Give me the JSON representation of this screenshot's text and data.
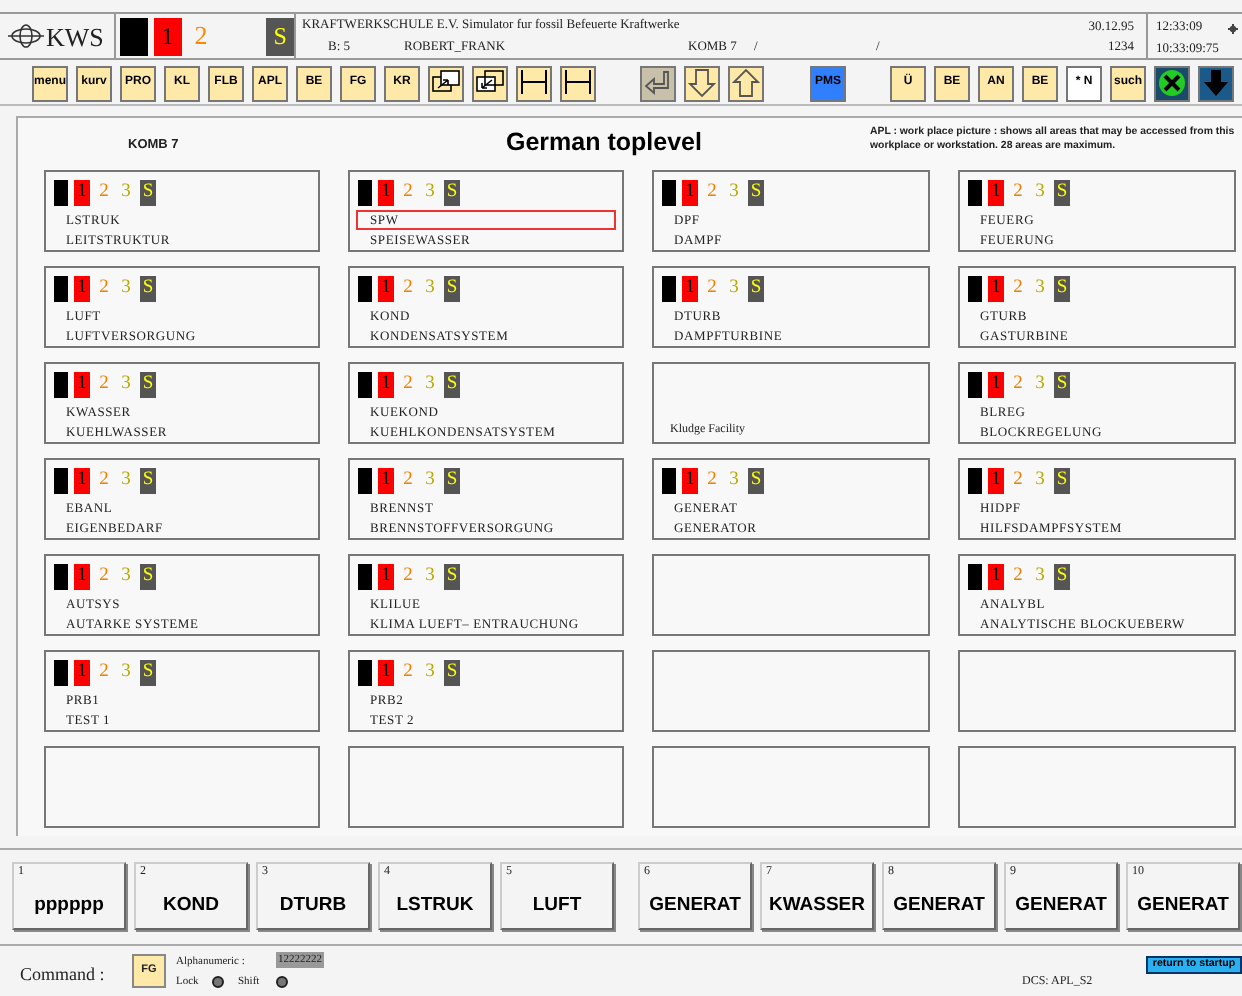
{
  "header": {
    "logo": "KWS",
    "indicators": [
      {
        "kind": "black"
      },
      {
        "kind": "red",
        "label": "1"
      },
      {
        "kind": "orange",
        "label": "2"
      },
      {
        "kind": "gap"
      },
      {
        "kind": "s",
        "label": "S"
      }
    ],
    "org": "KRAFTWERKSCHULE E.V.  Simulator fur fossil Befeuerte Kraftwerke",
    "date": "30.12.95",
    "b": "B: 5",
    "user": "ROBERT_FRANK",
    "unit": "KOMB 7",
    "slash_1": "/",
    "slash_2": "/",
    "code": "1234",
    "time": "12:33:09",
    "time_precise": "10:33:09:75"
  },
  "toolbar": [
    [
      {
        "kind": "text",
        "label": "menu"
      },
      {
        "kind": "text",
        "label": "kurv"
      },
      {
        "kind": "text",
        "label": "PRO"
      },
      {
        "kind": "text",
        "label": "KL"
      },
      {
        "kind": "text",
        "label": "FLB"
      },
      {
        "kind": "text",
        "label": "APL"
      },
      {
        "kind": "text",
        "label": "BE"
      },
      {
        "kind": "text",
        "label": "FG"
      },
      {
        "kind": "text",
        "label": "KR"
      },
      {
        "kind": "window-out"
      },
      {
        "kind": "window-in"
      },
      {
        "kind": "span"
      },
      {
        "kind": "span"
      }
    ],
    [
      {
        "kind": "return",
        "color": "#c8c0a8"
      },
      {
        "kind": "down"
      },
      {
        "kind": "up"
      }
    ],
    [
      {
        "kind": "text",
        "label": "PMS",
        "color": "#2f7fff"
      }
    ],
    [
      {
        "kind": "text",
        "label": "Ü"
      },
      {
        "kind": "text",
        "label": "BE"
      },
      {
        "kind": "text",
        "label": "AN"
      },
      {
        "kind": "text",
        "label": "BE"
      },
      {
        "kind": "text",
        "label": "* N",
        "color": "#ffffff"
      },
      {
        "kind": "text",
        "label": "such"
      },
      {
        "kind": "green-x",
        "color": "#1a4a6a"
      },
      {
        "kind": "blue-down",
        "color": "#1a5a8a"
      }
    ]
  ],
  "panel": {
    "unit": "KOMB 7",
    "title": "German toplevel",
    "info": "APL : work place picture : shows all areas that may be accessed from this workplace or workstation.  28 areas are maximum.",
    "areas": [
      {
        "kind": "area",
        "code": "LSTRUK",
        "name": "LEITSTRUKTUR",
        "selected": false,
        "indicators": [
          "1",
          "2",
          "3",
          "S"
        ]
      },
      {
        "kind": "area",
        "code": "SPW",
        "name": "SPEISEWASSER",
        "selected": true,
        "indicators": [
          "1",
          "2",
          "3",
          "S"
        ]
      },
      {
        "kind": "area",
        "code": "DPF",
        "name": "DAMPF",
        "selected": false,
        "indicators": [
          "1",
          "2",
          "3",
          "S"
        ]
      },
      {
        "kind": "area",
        "code": "FEUERG",
        "name": "FEUERUNG",
        "selected": false,
        "indicators": [
          "1",
          "2",
          "3",
          "S"
        ]
      },
      {
        "kind": "area",
        "code": "LUFT",
        "name": "LUFTVERSORGUNG",
        "selected": false,
        "indicators": [
          "1",
          "2",
          "3",
          "S"
        ]
      },
      {
        "kind": "area",
        "code": "KOND",
        "name": "KONDENSATSYSTEM",
        "selected": false,
        "indicators": [
          "1",
          "2",
          "3",
          "S"
        ]
      },
      {
        "kind": "area",
        "code": "DTURB",
        "name": "DAMPFTURBINE",
        "selected": false,
        "indicators": [
          "1",
          "2",
          "3",
          "S"
        ]
      },
      {
        "kind": "area",
        "code": "GTURB",
        "name": "GASTURBINE",
        "selected": false,
        "indicators": [
          "1",
          "2",
          "3",
          "S"
        ]
      },
      {
        "kind": "area",
        "code": "KWASSER",
        "name": "KUEHLWASSER",
        "selected": false,
        "indicators": [
          "1",
          "2",
          "3",
          "S"
        ]
      },
      {
        "kind": "area",
        "code": "KUEKOND",
        "name": "KUEHLKONDENSATSYSTEM",
        "selected": false,
        "indicators": [
          "1",
          "2",
          "3",
          "S"
        ]
      },
      {
        "kind": "label",
        "text": "Kludge Facility"
      },
      {
        "kind": "area",
        "code": "BLREG",
        "name": "BLOCKREGELUNG",
        "selected": false,
        "indicators": [
          "1",
          "2",
          "3",
          "S"
        ]
      },
      {
        "kind": "area",
        "code": "EBANL",
        "name": "EIGENBEDARF",
        "selected": false,
        "indicators": [
          "1",
          "2",
          "3",
          "S"
        ]
      },
      {
        "kind": "area",
        "code": "BRENNST",
        "name": "BRENNSTOFFVERSORGUNG",
        "selected": false,
        "indicators": [
          "1",
          "2",
          "3",
          "S"
        ]
      },
      {
        "kind": "area",
        "code": "GENERAT",
        "name": "GENERATOR",
        "selected": false,
        "indicators": [
          "1",
          "2",
          "3",
          "S"
        ]
      },
      {
        "kind": "area",
        "code": "HIDPF",
        "name": "HILFSDAMPFSYSTEM",
        "selected": false,
        "indicators": [
          "1",
          "2",
          "3",
          "S"
        ]
      },
      {
        "kind": "area",
        "code": "AUTSYS",
        "name": "AUTARKE SYSTEME",
        "selected": false,
        "indicators": [
          "1",
          "2",
          "3",
          "S"
        ]
      },
      {
        "kind": "area",
        "code": "KLILUE",
        "name": "KLIMA LUEFT– ENTRAUCHUNG",
        "selected": false,
        "indicators": [
          "1",
          "2",
          "3",
          "S"
        ]
      },
      {
        "kind": "empty"
      },
      {
        "kind": "area",
        "code": "ANALYBL",
        "name": "ANALYTISCHE BLOCKUEBERW",
        "selected": false,
        "indicators": [
          "1",
          "2",
          "3",
          "S"
        ]
      },
      {
        "kind": "area",
        "code": "PRB1",
        "name": "TEST 1",
        "selected": false,
        "indicators": [
          "1",
          "2",
          "3",
          "S"
        ]
      },
      {
        "kind": "area",
        "code": "PRB2",
        "name": "TEST 2",
        "selected": false,
        "indicators": [
          "1",
          "2",
          "3",
          "S"
        ]
      },
      {
        "kind": "empty"
      },
      {
        "kind": "empty"
      },
      {
        "kind": "empty"
      },
      {
        "kind": "empty"
      },
      {
        "kind": "empty"
      },
      {
        "kind": "empty"
      }
    ]
  },
  "function_keys": [
    {
      "number": "1",
      "label": "pppppp"
    },
    {
      "number": "2",
      "label": "KOND"
    },
    {
      "number": "3",
      "label": "DTURB"
    },
    {
      "number": "4",
      "label": "LSTRUK"
    },
    {
      "number": "5",
      "label": "LUFT"
    },
    {
      "number": "6",
      "label": "GENERAT"
    },
    {
      "number": "7",
      "label": "KWASSER"
    },
    {
      "number": "8",
      "label": "GENERAT"
    },
    {
      "number": "9",
      "label": "GENERAT"
    },
    {
      "number": "10",
      "label": "GENERAT"
    }
  ],
  "command_bar": {
    "label": "Command :",
    "button": "FG",
    "alnum_label": "Alphanumeric :",
    "alnum_value": "12222222",
    "lock": {
      "label": "Lock",
      "on": false
    },
    "shift": {
      "label": "Shift",
      "on": false
    },
    "dcs": "DCS: APL_S2",
    "return_button": "return to startup"
  }
}
